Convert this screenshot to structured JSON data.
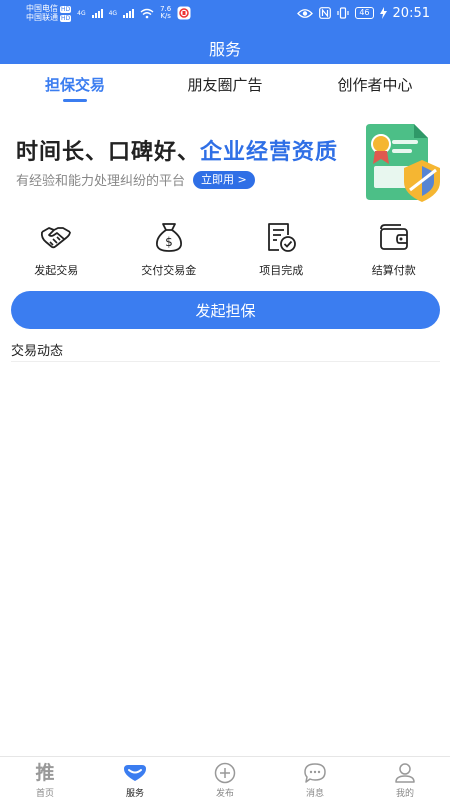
{
  "status_bar": {
    "carrier1": "中国电信",
    "carrier2": "中国联通",
    "hd": "HD",
    "net1": "4G",
    "net2": "4G",
    "speed_value": "7.6",
    "speed_unit": "K/s",
    "battery": "46",
    "time": "20:51"
  },
  "header": {
    "title": "服务"
  },
  "tabs": [
    {
      "label": "担保交易",
      "active": true
    },
    {
      "label": "朋友圈广告",
      "active": false
    },
    {
      "label": "创作者中心",
      "active": false
    }
  ],
  "banner": {
    "headline_part1": "时间长、口碑好、",
    "headline_part2": "企业经营资质",
    "subline": "有经验和能力处理纠纷的平台",
    "cta": "立即用 >"
  },
  "actions": [
    {
      "label": "发起交易",
      "icon": "handshake-icon"
    },
    {
      "label": "交付交易金",
      "icon": "money-bag-icon"
    },
    {
      "label": "项目完成",
      "icon": "document-check-icon"
    },
    {
      "label": "结算付款",
      "icon": "wallet-icon"
    }
  ],
  "primary_button": {
    "label": "发起担保"
  },
  "section": {
    "title": "交易动态"
  },
  "bottom_nav": [
    {
      "label": "首页",
      "icon": "tui-icon",
      "glyph": "推"
    },
    {
      "label": "服务",
      "icon": "service-icon"
    },
    {
      "label": "发布",
      "icon": "plus-circle-icon"
    },
    {
      "label": "消息",
      "icon": "chat-bubble-icon"
    },
    {
      "label": "我的",
      "icon": "profile-icon"
    }
  ],
  "colors": {
    "primary": "#3b7df0",
    "highlight": "#2f6fe6",
    "icon_stroke": "#222222",
    "muted": "#888888"
  }
}
